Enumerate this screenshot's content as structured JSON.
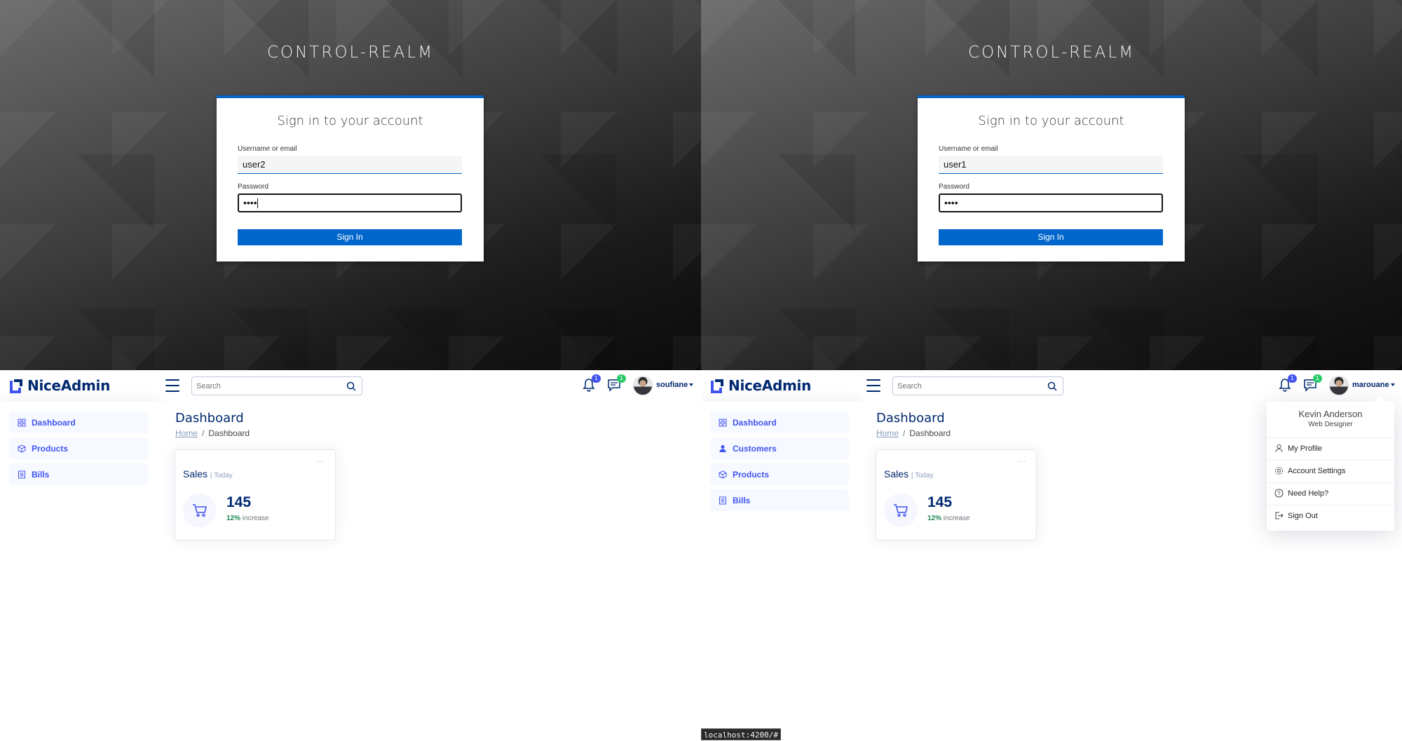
{
  "login_left": {
    "realm": "CONTROL-REALM",
    "card_title": "Sign in to your account",
    "username_label": "Username or email",
    "username_value": "user2",
    "password_label": "Password",
    "password_value": "••••",
    "signin_label": "Sign In"
  },
  "login_right": {
    "realm": "CONTROL-REALM",
    "card_title": "Sign in to your account",
    "username_label": "Username or email",
    "username_value": "user1",
    "password_label": "Password",
    "password_value": "••••",
    "signin_label": "Sign In"
  },
  "dash_left": {
    "logo": "NiceAdmin",
    "search_placeholder": "Search",
    "notif_badge": "1",
    "msg_badge": "1",
    "username": "soufiane",
    "sidebar": [
      "Dashboard",
      "Products",
      "Bills"
    ],
    "page_title": "Dashboard",
    "breadcrumb_home": "Home",
    "breadcrumb_sep": "/",
    "breadcrumb_current": "Dashboard",
    "card": {
      "title": "Sales",
      "sub": "| Today",
      "value": "145",
      "pct": "12%",
      "pct_text": "increase",
      "menu": "..."
    }
  },
  "dash_right": {
    "logo": "NiceAdmin",
    "search_placeholder": "Search",
    "notif_badge": "1",
    "msg_badge": "1",
    "username": "marouane",
    "sidebar": [
      "Dashboard",
      "Customers",
      "Products",
      "Bills"
    ],
    "page_title": "Dashboard",
    "breadcrumb_home": "Home",
    "breadcrumb_sep": "/",
    "breadcrumb_current": "Dashboard",
    "card": {
      "title": "Sales",
      "sub": "| Today",
      "value": "145",
      "pct": "12%",
      "pct_text": "increase",
      "menu": "..."
    },
    "dropdown": {
      "name": "Kevin Anderson",
      "role": "Web Designer",
      "items": [
        "My Profile",
        "Account Settings",
        "Need Help?",
        "Sign Out"
      ]
    }
  },
  "status_url": "localhost:4200/#",
  "colors": {
    "primary": "#4154f1",
    "navy": "#012970",
    "keycloak_blue": "#0066cc",
    "success": "#198754"
  }
}
